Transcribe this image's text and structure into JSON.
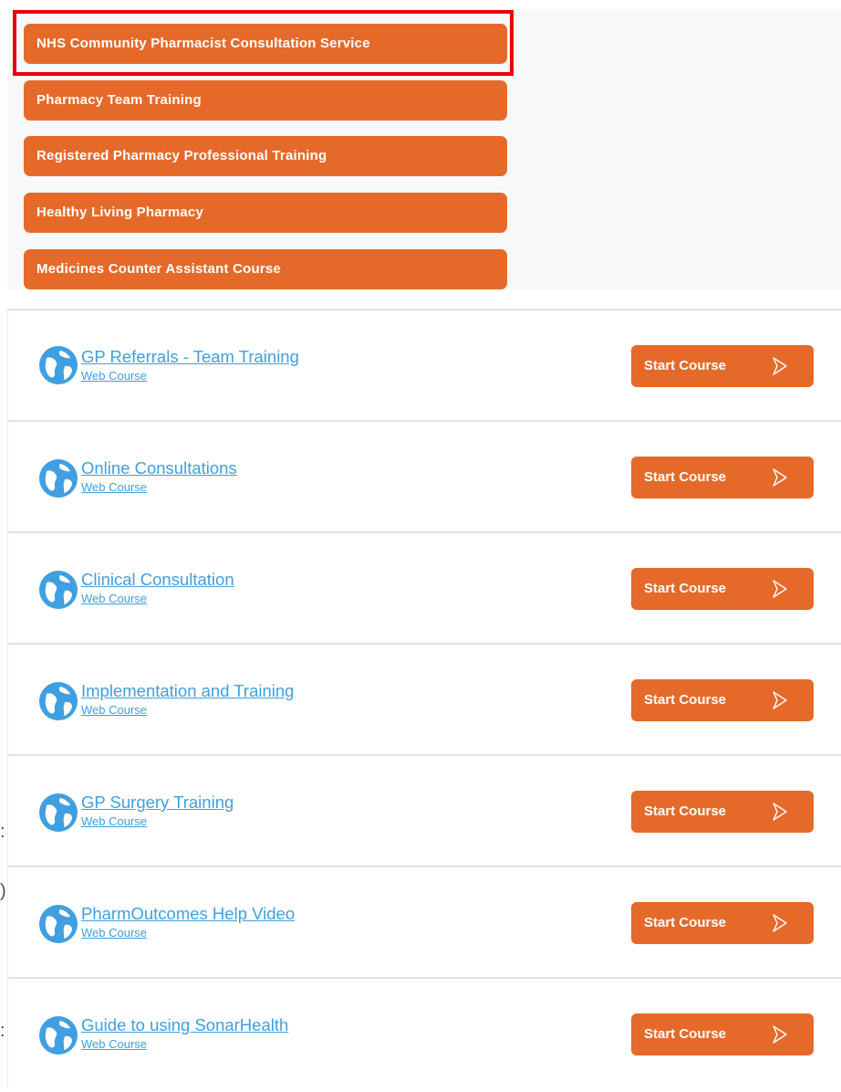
{
  "categories": [
    {
      "label": "NHS Community Pharmacist Consultation Service",
      "highlighted": true
    },
    {
      "label": "Pharmacy Team Training",
      "highlighted": false
    },
    {
      "label": "Registered Pharmacy Professional Training",
      "highlighted": false
    },
    {
      "label": "Healthy Living Pharmacy",
      "highlighted": false
    },
    {
      "label": "Medicines Counter Assistant Course",
      "highlighted": false
    }
  ],
  "courses": [
    {
      "title": "GP Referrals - Team Training",
      "type": "Web Course",
      "button": "Start Course",
      "icon": "globe-icon"
    },
    {
      "title": "Online Consultations",
      "type": "Web Course",
      "button": "Start Course",
      "icon": "globe-icon"
    },
    {
      "title": "Clinical Consultation",
      "type": "Web Course",
      "button": "Start Course",
      "icon": "globe-icon"
    },
    {
      "title": "Implementation and Training",
      "type": "Web Course",
      "button": "Start Course",
      "icon": "globe-icon"
    },
    {
      "title": "GP Surgery Training",
      "type": "Web Course",
      "button": "Start Course",
      "icon": "globe-icon"
    },
    {
      "title": "PharmOutcomes Help Video",
      "type": "Web Course",
      "button": "Start Course",
      "icon": "globe-icon"
    },
    {
      "title": "Guide to using SonarHealth",
      "type": "Web Course",
      "button": "Start Course",
      "icon": "globe-icon"
    }
  ],
  "colors": {
    "accent": "#e56a2a",
    "link": "#3f9fe0",
    "highlight": "#e8000b",
    "panel_bg": "#f7f8fa"
  }
}
